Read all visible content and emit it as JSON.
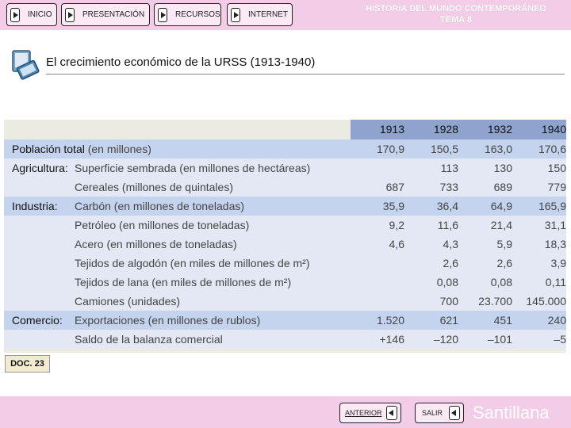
{
  "nav": {
    "inicio": "INICIO",
    "presentacion": "PRESENTACIÓN",
    "recursos": "RECURSOS",
    "internet": "INTERNET"
  },
  "header": {
    "line1": "HISTORIA DEL MUNDO CONTEMPORÁNEO",
    "line2": "TEMA 8"
  },
  "page_title": "El crecimiento económico de la URSS (1913-1940)",
  "table": {
    "years": [
      "1913",
      "1928",
      "1932",
      "1940"
    ],
    "rows": [
      {
        "category": "Población total",
        "category_unit": " (en millones)",
        "label": "",
        "values": [
          "170,9",
          "150,5",
          "163,0",
          "170,6"
        ]
      },
      {
        "category": "Agricultura:",
        "category_unit": "",
        "label": "Superficie sembrada (en millones de hectáreas)",
        "values": [
          "",
          "113",
          "130",
          "150"
        ]
      },
      {
        "category": "",
        "category_unit": "",
        "label": "Cereales (millones de quintales)",
        "values": [
          "687",
          "733",
          "689",
          "779"
        ]
      },
      {
        "category": "Industria:",
        "category_unit": "",
        "label": "Carbón (en millones de toneladas)",
        "values": [
          "35,9",
          "36,4",
          "64,9",
          "165,9"
        ]
      },
      {
        "category": "",
        "category_unit": "",
        "label": "Petróleo (en millones de toneladas)",
        "values": [
          "9,2",
          "11,6",
          "21,4",
          "31,1"
        ]
      },
      {
        "category": "",
        "category_unit": "",
        "label": "Acero (en millones de toneladas)",
        "values": [
          "4,6",
          "4,3",
          "5,9",
          "18,3"
        ]
      },
      {
        "category": "",
        "category_unit": "",
        "label": "Tejidos de algodón (en miles de millones de m²)",
        "values": [
          "",
          "2,6",
          "2,6",
          "3,9"
        ]
      },
      {
        "category": "",
        "category_unit": "",
        "label": "Tejidos de lana (en miles de millones de m²)",
        "values": [
          "",
          "0,08",
          "0,08",
          "0,11"
        ]
      },
      {
        "category": "",
        "category_unit": "",
        "label": "Camiones (unidades)",
        "values": [
          "",
          "700",
          "23.700",
          "145.000"
        ]
      },
      {
        "category": "Comercio:",
        "category_unit": "",
        "label": "Exportaciones (en millones de rublos)",
        "values": [
          "1.520",
          "621",
          "451",
          "240"
        ]
      },
      {
        "category": "",
        "category_unit": "",
        "label": "Saldo de la balanza comercial",
        "values": [
          "+146",
          "–120",
          "–101",
          "–5"
        ]
      }
    ]
  },
  "doc_label": "DOC. 23",
  "footer": {
    "anterior": "ANTERIOR",
    "salir": "SALIR",
    "brand": "Santillana"
  },
  "colors": {
    "bar_pink": "#f3cce8",
    "year_header": "#8ea4cf",
    "row_blue": "#c5d4ee",
    "row_light": "#e3e8f4",
    "table_bg": "#ecebe2"
  },
  "icons": {
    "nav": "play-triangle-icon",
    "back": "back-triangle-icon",
    "document": "document-icon"
  }
}
